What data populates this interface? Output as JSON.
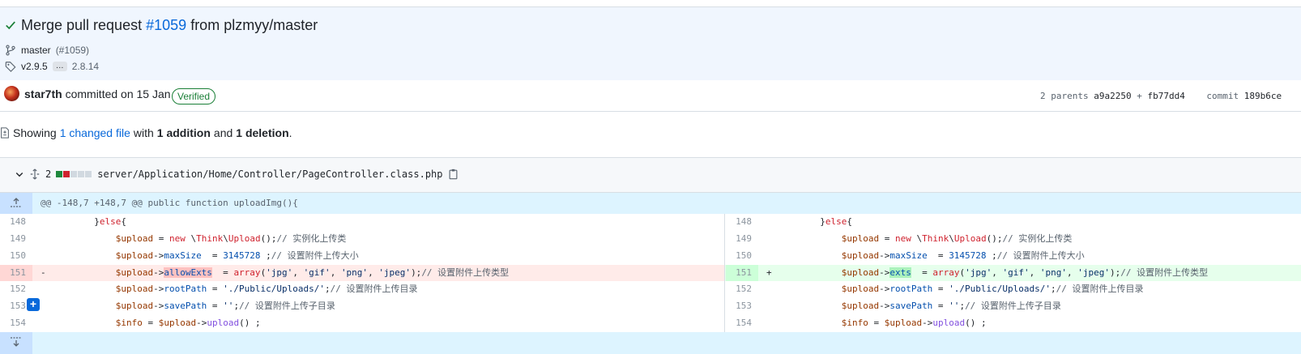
{
  "commit": {
    "title_prefix": "Merge pull request",
    "title_pr": "#1059",
    "title_suffix": "from plzmyy/master",
    "branch": "master",
    "branch_pr": "(#1059)",
    "tag_start": "v2.9.5",
    "tag_ellipsis": "…",
    "tag_end": "2.8.14",
    "author": "star7th",
    "committed_text": "committed on 15 Jan",
    "verified_label": "Verified",
    "parents_label": "2 parents",
    "parent1": "a9a2250",
    "parent_sep": "+",
    "parent2": "fb77dd4",
    "commit_label": "commit",
    "commit_sha": "189b6ce"
  },
  "summary": {
    "showing": "Showing",
    "changed": "1 changed file",
    "with": "with",
    "addition": "1 addition",
    "and": "and",
    "deletion": "1 deletion",
    "period": "."
  },
  "file": {
    "change_count": "2",
    "path": "server/Application/Home/Controller/PageController.class.php"
  },
  "diff": {
    "hunk_header": "@@ -148,7 +148,7 @@ public function uploadImg(){",
    "left_lines": [
      "148",
      "149",
      "150",
      "151",
      "152",
      "153",
      "154"
    ],
    "right_lines": [
      "148",
      "149",
      "150",
      "151",
      "152",
      "153",
      "154"
    ],
    "del_sign": "-",
    "add_sign": "+"
  },
  "colors": {
    "link": "#0969da",
    "verified": "#1a7f37",
    "deletion_bg": "#ffebe9",
    "addition_bg": "#e6ffec",
    "hunk_bg": "#ddf4ff"
  },
  "icons": [
    "check-icon",
    "branch-icon",
    "tag-icon",
    "avatar",
    "file-diff-icon",
    "chevron-down-icon",
    "expand-icon",
    "copy-icon",
    "expand-up-icon",
    "expand-down-icon",
    "add-comment-icon"
  ]
}
